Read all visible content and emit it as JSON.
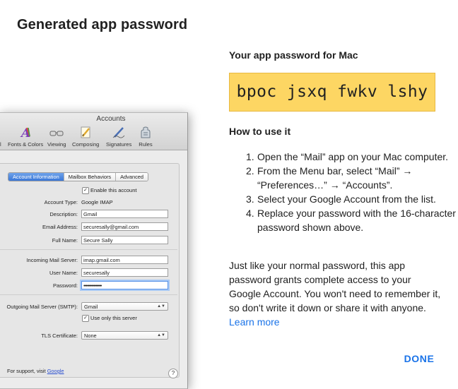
{
  "dialog": {
    "title": "Generated app password",
    "password_heading": "Your app password for Mac",
    "password": "bpoc jsxq fwkv lshy",
    "howto_heading": "How to use it",
    "steps": [
      {
        "num": "1.",
        "text": "Open the “Mail” app on your Mac computer."
      },
      {
        "num": "2.",
        "text": "From the Menu bar, select “Mail” → “Preferences…” → “Accounts”."
      },
      {
        "num": "3.",
        "text": "Select your Google Account from the list."
      },
      {
        "num": "4.",
        "text": "Replace your password with the 16-character password shown above."
      }
    ],
    "body_text": "Just like your normal password, this app password grants complete access to your Google Account. You won't need to remember it, so don't write it down or share it with anyone.",
    "learn_more": "Learn more",
    "done_label": "DONE",
    "colors": {
      "password_bg": "#fdd663",
      "link": "#1a73e8"
    }
  },
  "mac_window": {
    "title": "Accounts",
    "toolbar": [
      {
        "label": "il",
        "icon": "at-icon"
      },
      {
        "label": "Fonts & Colors",
        "icon": "fonts-colors-icon"
      },
      {
        "label": "Viewing",
        "icon": "glasses-icon"
      },
      {
        "label": "Composing",
        "icon": "pencil-icon"
      },
      {
        "label": "Signatures",
        "icon": "signature-pen-icon"
      },
      {
        "label": "Rules",
        "icon": "rules-icon"
      }
    ],
    "tabs": [
      "Account Information",
      "Mailbox Behaviors",
      "Advanced"
    ],
    "enable_label": "Enable this account",
    "account_type_label": "Account Type:",
    "account_type_value": "Google IMAP",
    "description_label": "Description:",
    "description_value": "Gmail",
    "email_label": "Email Address:",
    "email_value": "securesally@gmail.com",
    "fullname_label": "Full Name:",
    "fullname_value": "Secure Sally",
    "incoming_label": "Incoming Mail Server:",
    "incoming_value": "imap.gmail.com",
    "username_label": "User Name:",
    "username_value": "securesally",
    "password_label": "Password:",
    "password_value": "••••••••••••••••",
    "smtp_label": "Outgoing Mail Server (SMTP):",
    "smtp_value": "Gmail",
    "only_server_label": "Use only this server",
    "tls_label": "TLS Certificate:",
    "tls_value": "None",
    "support_text": "For support, visit ",
    "support_link": "Google",
    "help_glyph": "?"
  }
}
